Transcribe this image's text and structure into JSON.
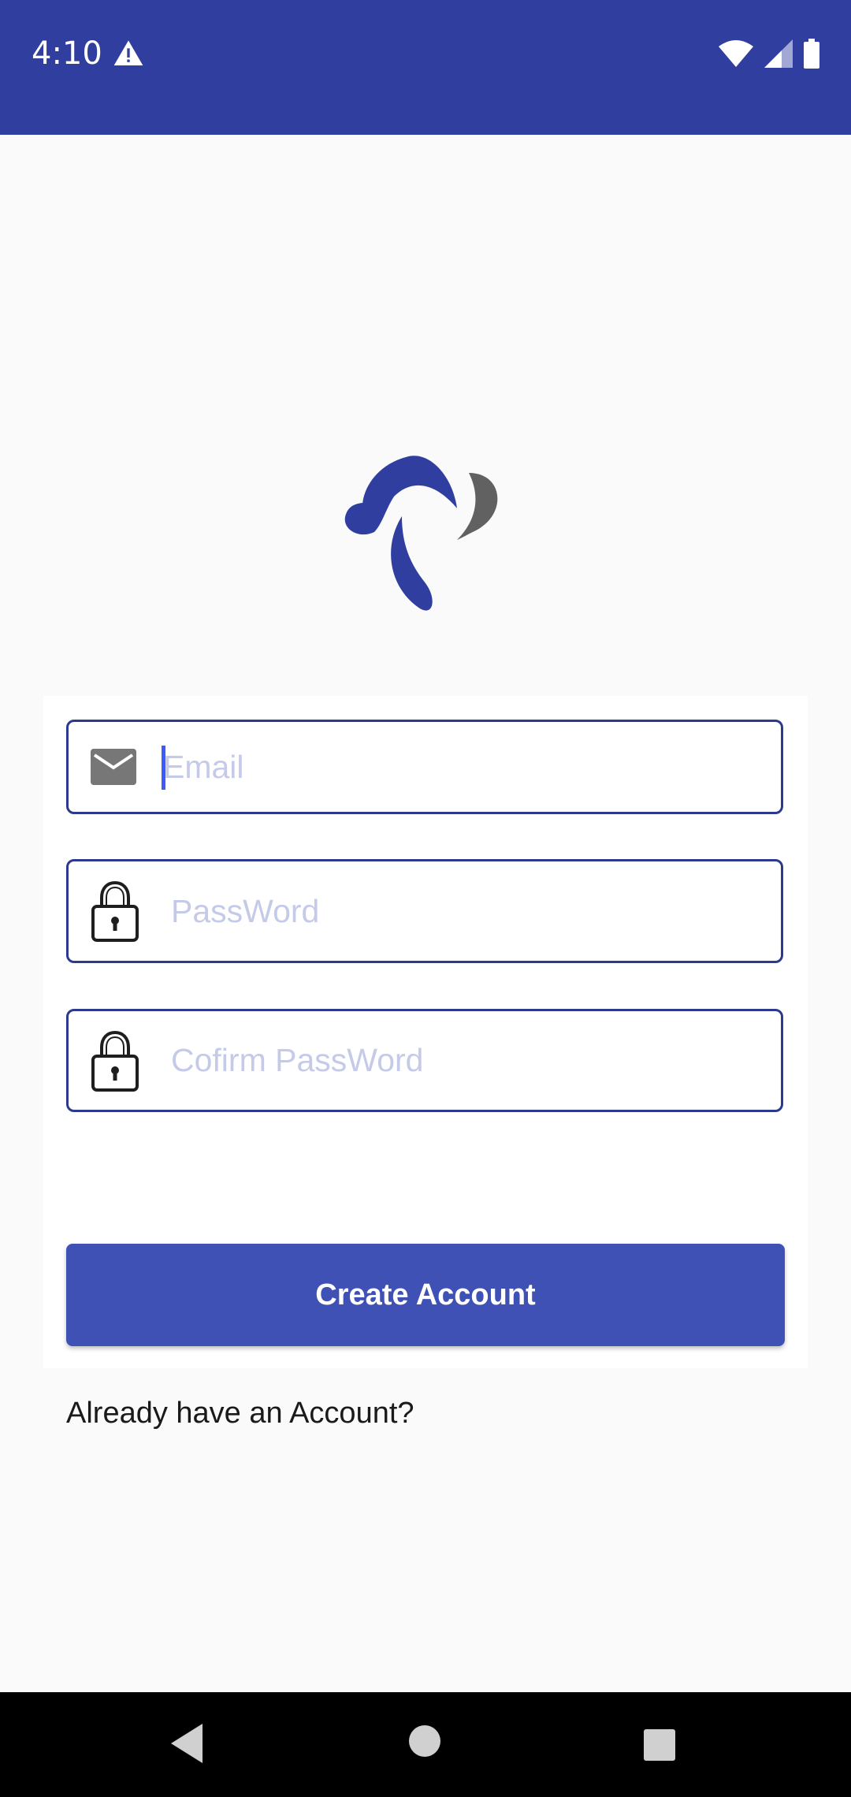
{
  "status_bar": {
    "time": "4:10",
    "background": "#303F9F",
    "icons": [
      "warning-icon",
      "wifi-icon",
      "signal-icon",
      "battery-icon"
    ]
  },
  "logo": {
    "icon": "app-logo",
    "colors": {
      "primary": "#303F9F",
      "secondary": "#616161"
    }
  },
  "form": {
    "email": {
      "placeholder": "Email",
      "value": "",
      "icon": "mail-icon"
    },
    "password": {
      "placeholder": "PassWord",
      "value": "",
      "icon": "lock-icon"
    },
    "confirm_password": {
      "placeholder": "Cofirm PassWord",
      "value": "",
      "icon": "lock-icon"
    },
    "create_button_label": "Create Account",
    "button_color": "#3F51B5",
    "field_border_color": "#2B3A8F"
  },
  "login_prompt": "Already have an Account?",
  "nav_bar": {
    "icons": [
      "back-icon",
      "home-icon",
      "recents-icon"
    ]
  }
}
